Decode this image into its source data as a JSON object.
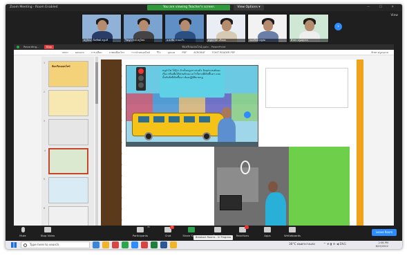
{
  "titlebar": {
    "app_title": "Zoom Meeting - Room Enabled",
    "viewing_notice": "You are viewing Teacher's screen",
    "view_options": "View Options ▾",
    "window_controls": "— ☐ ✕"
  },
  "gallery": {
    "participants": [
      {
        "name": "ครูรัตนา นิลทิพย์ ครูแท้"
      },
      {
        "name": "วิชญาภรณ์ ครูใหม่"
      },
      {
        "name": "อ.ธงชัย สวนแก้ว"
      },
      {
        "name": "ครูสุภาพร เกิดผล"
      },
      {
        "name": "กมลรัตน์ ครูสม"
      },
      {
        "name": "ศิวพร ครูอนุบาล"
      }
    ],
    "view_label": "View"
  },
  "ppt": {
    "recording_label": "Recording...",
    "stop_label": "Stop",
    "doc_title": "ห้องเรียนออนไลน์.pptx - PowerPoint",
    "ribbon_tabs": [
      "แทรก",
      "ออกแบบ",
      "การเปลี่ยน",
      "ภาพเคลื่อนไหว",
      "การนำเสนอสไลด์",
      "รีวิว",
      "มุมมอง",
      "PDF",
      "ACROBAT",
      "FOXIT READER PDF"
    ],
    "account_label": "ศิวพร ครูอนุบาล",
    "slides": [
      {
        "num": "1",
        "title": "ห้องเรียนออนไลน์"
      },
      {
        "num": "2",
        "title": ""
      },
      {
        "num": "3",
        "title": ""
      },
      {
        "num": "4",
        "title": ""
      },
      {
        "num": "5",
        "title": ""
      },
      {
        "num": "6",
        "title": ""
      }
    ],
    "textbox_placeholder": "",
    "video_speech": "หนูจ๋าไฟ ให้รู้ว่า ถ้าเห็นกฎจราจรแล้ว วัตถุประสงค์ของเรื่อง หรือเพื่อให้ส่วนตัวเอง อะไรก็ตามที่เกิดขึ้นมา แบบนั้นกับสิ่งที่เกิดขึ้นมา ต้องปฏิบัติตามกฎ"
  },
  "toolbar": {
    "mute": "Mute",
    "stop_video": "Stop Video",
    "participants": "Participants",
    "participants_count": "31",
    "chat": "Chat",
    "chat_badge": "2",
    "share_screen": "Share Screen",
    "record": "Record",
    "reactions": "Reactions",
    "apps": "Apps",
    "whiteboards": "Whiteboards",
    "breakout": "Breakout Rooms - In Progress",
    "leave": "Leave Room"
  },
  "taskbar": {
    "search_placeholder": "Type here to search",
    "weather": "30°C",
    "weather_desc": "ฝนตกบางแห่ง",
    "tray_icons": "^ ⊕ ▮ ☰ ◀ ENG",
    "time": "2:58 PM",
    "date": "6/25/2022",
    "app_colors": [
      "#3a87d8",
      "#f0b429",
      "#d64541",
      "#2ea44f",
      "#2d8cff",
      "#d64541",
      "#1e7f3d",
      "#2b5797",
      "#f0b429"
    ]
  }
}
